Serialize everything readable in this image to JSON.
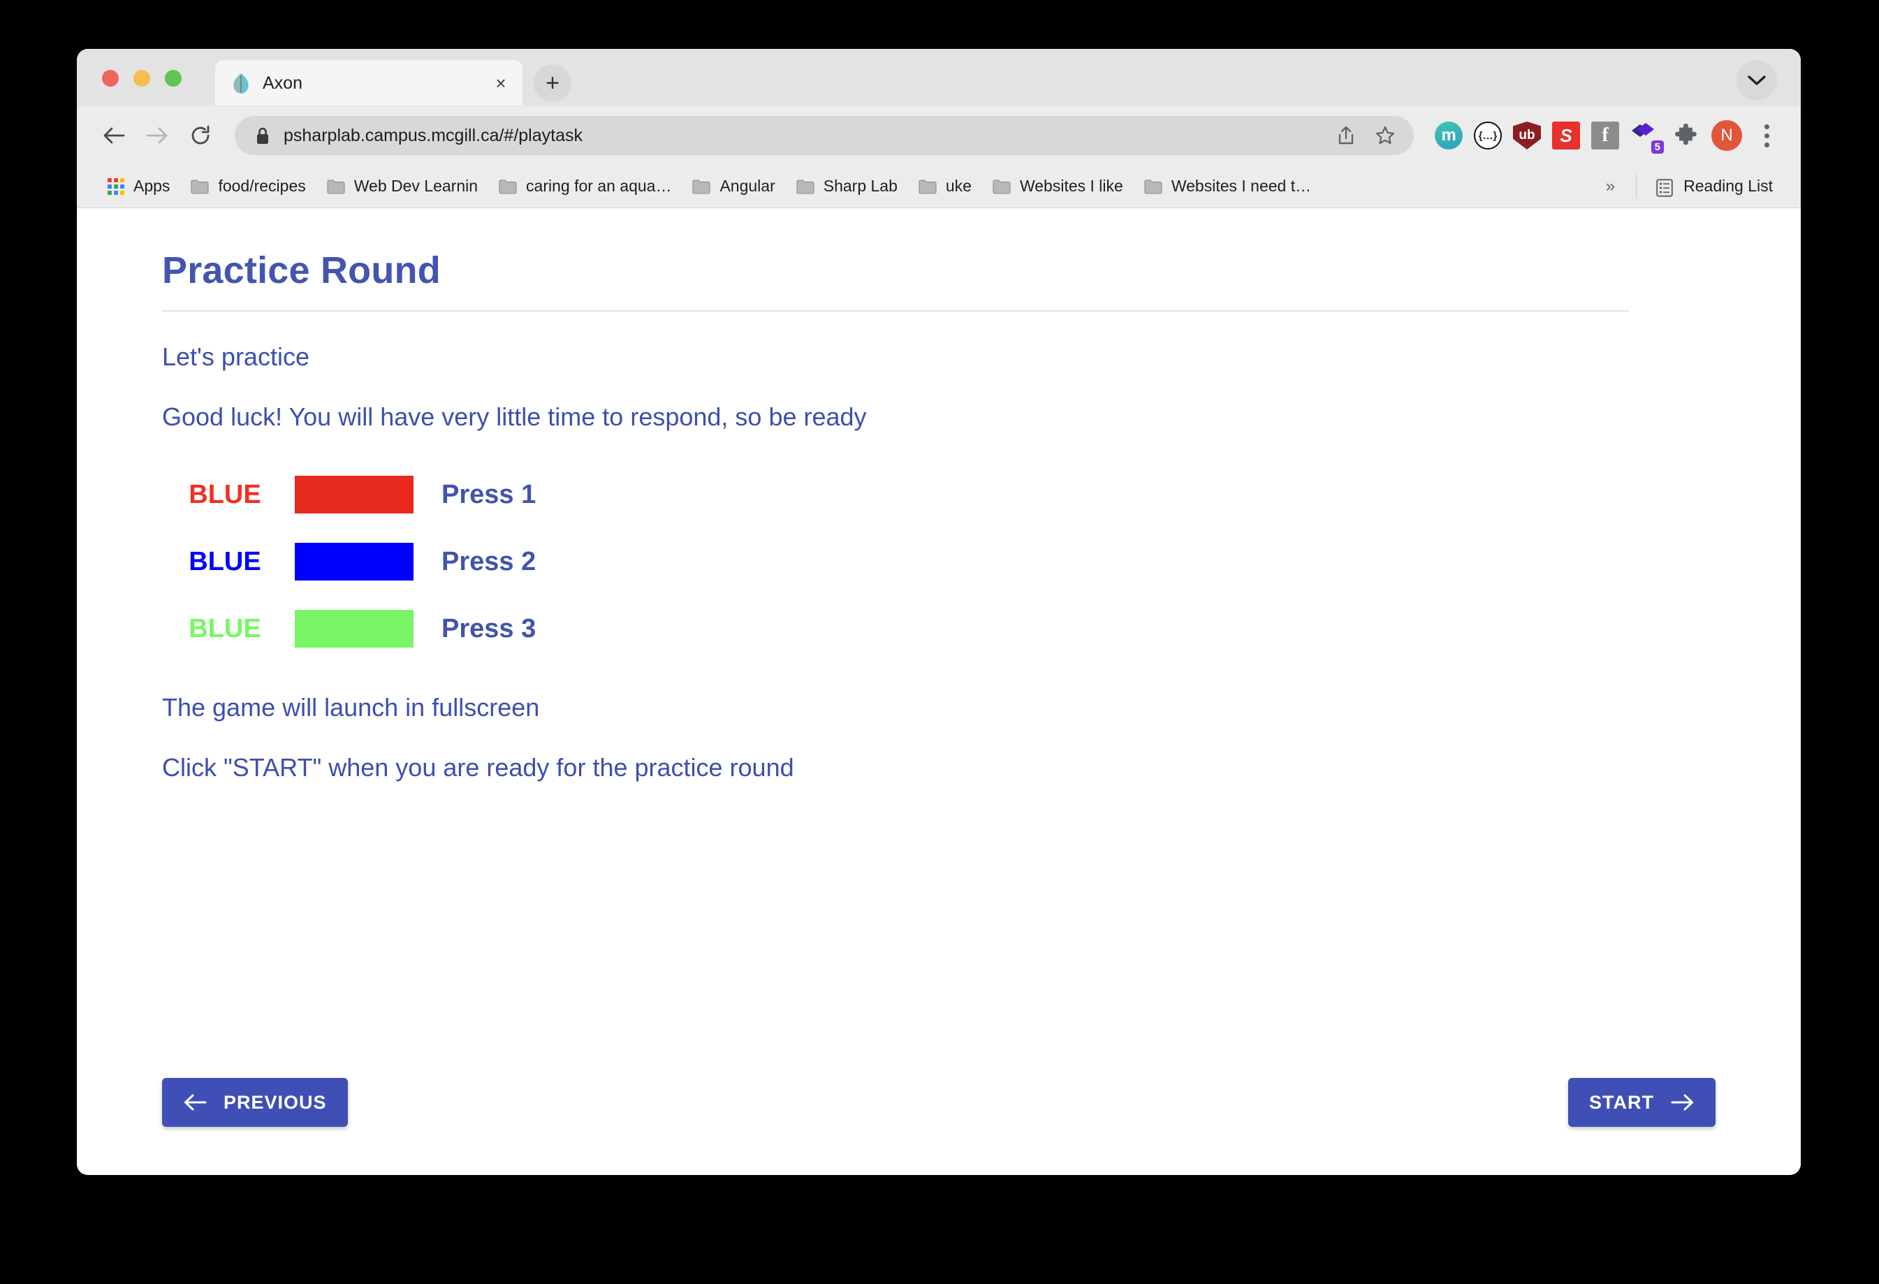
{
  "browser": {
    "tab": {
      "title": "Axon",
      "favicon": "leaf-favicon",
      "close_label": "×"
    },
    "new_tab_label": "+",
    "omnibox": {
      "url": "psharplab.campus.mcgill.ca/#/playtask",
      "lock_icon": "lock-icon"
    },
    "extensions": [
      {
        "name": "mendeley-extension",
        "label": "m"
      },
      {
        "name": "json-viewer-extension",
        "label": "{…}"
      },
      {
        "name": "ublock-origin-extension",
        "label": "ub"
      },
      {
        "name": "s-extension",
        "label": "S"
      },
      {
        "name": "facebook-extension",
        "label": "f"
      },
      {
        "name": "diamond-extension",
        "label": "",
        "badge": "5"
      },
      {
        "name": "extensions-puzzle",
        "label": ""
      }
    ],
    "profile_initial": "N",
    "bookmarks": [
      {
        "label": "Apps",
        "icon": "apps-grid-icon"
      },
      {
        "label": "food/recipes",
        "icon": "folder-icon"
      },
      {
        "label": "Web Dev Learnin",
        "icon": "folder-icon"
      },
      {
        "label": "caring for an aqua…",
        "icon": "folder-icon"
      },
      {
        "label": "Angular",
        "icon": "folder-icon"
      },
      {
        "label": "Sharp Lab",
        "icon": "folder-icon"
      },
      {
        "label": "uke",
        "icon": "folder-icon"
      },
      {
        "label": "Websites I like",
        "icon": "folder-icon"
      },
      {
        "label": "Websites I need t…",
        "icon": "folder-icon"
      }
    ],
    "bookmarks_overflow": "»",
    "reading_list": "Reading List"
  },
  "page": {
    "title": "Practice Round",
    "intro": "Let's practice",
    "warning": "Good luck! You will have very little time to respond, so be ready",
    "stimuli": [
      {
        "word": "BLUE",
        "word_color": "#ef3124",
        "swatch_color": "#e8291e",
        "press": "Press 1"
      },
      {
        "word": "BLUE",
        "word_color": "#0000ff",
        "swatch_color": "#0000ff",
        "press": "Press 2"
      },
      {
        "word": "BLUE",
        "word_color": "#79f566",
        "swatch_color": "#79f566",
        "press": "Press 3"
      }
    ],
    "fullscreen_note": "The game will launch in fullscreen",
    "start_note": "Click \"START\" when you are ready for the practice round",
    "previous_button": "PREVIOUS",
    "start_button": "START",
    "accent_color": "#3f4fb5",
    "text_color": "#3d4fb0"
  }
}
